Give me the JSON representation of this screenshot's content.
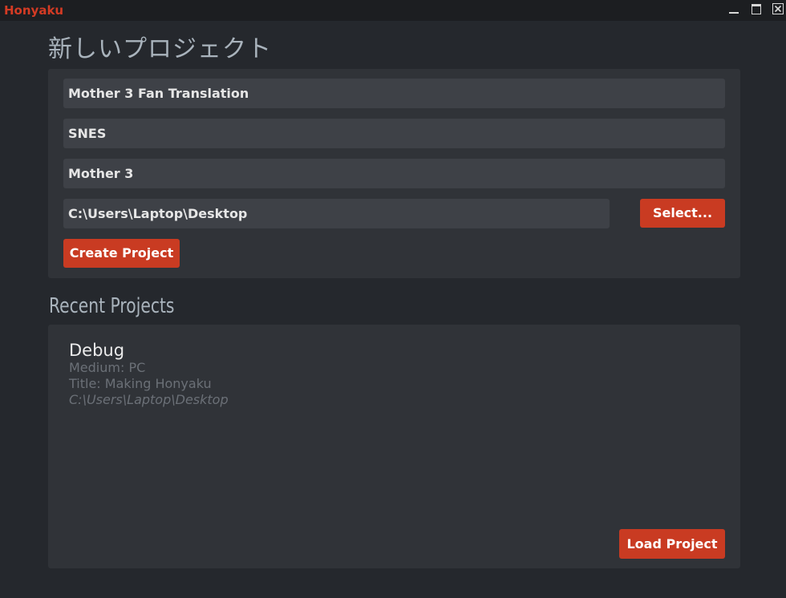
{
  "window": {
    "app_title": "Honyaku"
  },
  "new_project": {
    "heading": "新しいプロジェクト",
    "project_name": "Mother 3 Fan Translation",
    "medium": "SNES",
    "title": "Mother 3",
    "path": "C:\\Users\\Laptop\\Desktop",
    "select_label": "Select...",
    "create_label": "Create Project"
  },
  "recent": {
    "heading": "Recent Projects",
    "projects": [
      {
        "name": "Debug",
        "medium": "Medium: PC",
        "title": "Title: Making Honyaku",
        "path": "C:\\Users\\Laptop\\Desktop"
      }
    ],
    "load_label": "Load Project"
  },
  "colors": {
    "accent": "#c93b22",
    "background": "#25282d",
    "panel": "#303338",
    "field": "#3e4147"
  },
  "icons": {
    "minimize": "minimize-icon",
    "maximize": "maximize-icon",
    "close": "close-icon"
  }
}
